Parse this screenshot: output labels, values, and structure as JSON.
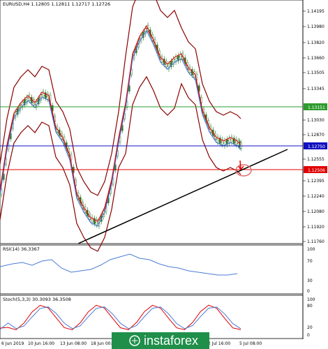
{
  "main_chart": {
    "header": "EURUSD,H4  1.12805 1.12811 1.12717 1.12726",
    "price_axis": [
      "1.14195",
      "1.13980",
      "1.13820",
      "1.13660",
      "1.13505",
      "1.13345",
      "1.13151",
      "1.13030",
      "1.12870",
      "1.12750",
      "1.12555",
      "1.12506",
      "1.12395",
      "1.12240",
      "1.12080",
      "1.11920",
      "1.11760"
    ],
    "level_labels": {
      "green": "1.13151",
      "blue": "1.12750",
      "red": "1.12506"
    },
    "colors": {
      "green_line": "#2e9b2e",
      "blue_line": "#1010c0",
      "red_line": "#e00000",
      "green_label_bg": "#2e9b2e",
      "blue_label_bg": "#1010c0",
      "red_label_bg": "#e00000",
      "bollinger": "#8b0000",
      "ma_fast": "#e00000",
      "ma_slow": "#4b7bd8",
      "candle": "#2a7a2a",
      "trendline": "#000000",
      "marker": "#e07070"
    }
  },
  "rsi_panel": {
    "header": "RSI(14) 36.3367",
    "axis": [
      "100",
      "70",
      "30",
      "0"
    ],
    "color": "#4b7bd8"
  },
  "stoch_panel": {
    "header": "Stoch(5,3,3) 30.3093 36.3508",
    "axis": [
      "100",
      "80",
      "20",
      "0"
    ],
    "colors": {
      "main": "#e00000",
      "signal": "#4b7bd8"
    }
  },
  "time_axis": [
    "6 Jun 2019",
    "10 Jun 16:00",
    "13 Jun 08:00",
    "18 Jun 00:00",
    "2 Jul 16:00",
    "5 Jul 08:00"
  ],
  "watermark": {
    "brand": "instaforex"
  }
}
